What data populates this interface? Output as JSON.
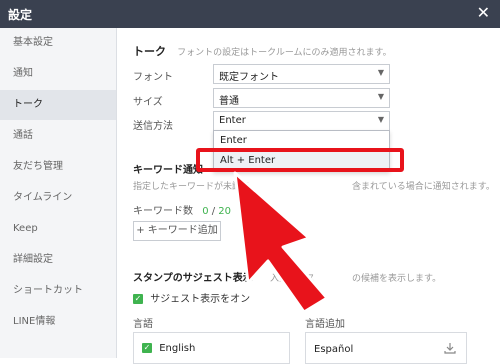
{
  "window": {
    "title": "設定",
    "close_glyph": "✕"
  },
  "sidebar": {
    "items": [
      {
        "label": "基本設定"
      },
      {
        "label": "通知"
      },
      {
        "label": "トーク"
      },
      {
        "label": "通話"
      },
      {
        "label": "友だち管理"
      },
      {
        "label": "タイムライン"
      },
      {
        "label": "Keep"
      },
      {
        "label": "詳細設定"
      },
      {
        "label": "ショートカット"
      },
      {
        "label": "LINE情報"
      }
    ],
    "active": "トーク"
  },
  "talk": {
    "title": "トーク",
    "note": "フォントの設定はトークルームにのみ適用されます。",
    "font_label": "フォント",
    "font_value": "既定フォント",
    "size_label": "サイズ",
    "size_value": "普通",
    "send_label": "送信方法",
    "send_value": "Enter",
    "send_options": [
      "Enter",
      "Alt + Enter"
    ]
  },
  "keyword": {
    "title": "キーワード通知",
    "note_left": "指定したキーワードが未読メ",
    "note_right": "含まれている場合に通知されます。",
    "count_label": "キーワード数",
    "count_current": "0",
    "count_sep": " / ",
    "count_max": "20",
    "add_button": "+ キーワード追加"
  },
  "stamp": {
    "title": "スタンプのサジェスト表示",
    "note_left": "入力中にス",
    "note_right": "の候補を表示します。",
    "checkbox_label": "サジェスト表示をオン",
    "lang_header": "言語",
    "lang_add_header": "言語追加",
    "lang_selected": "English",
    "lang_available": "Español"
  },
  "colors": {
    "accent": "#3fb34f",
    "highlight": "#e8131b",
    "titlebar": "#3a4150"
  },
  "icons": {
    "close": "close-icon",
    "chevron": "chevron-down-icon",
    "check": "check-icon",
    "download": "download-icon",
    "arrow": "red-arrow-annotation"
  }
}
